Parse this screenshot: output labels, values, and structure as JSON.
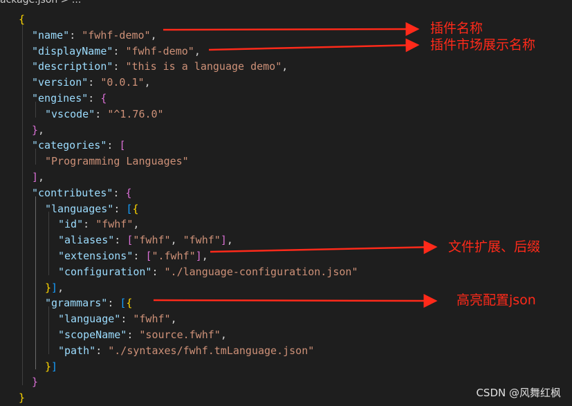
{
  "breadcrumb": {
    "text": "ackage.json > ..."
  },
  "colors": {
    "key": "#9cdcfe",
    "string": "#ce9178",
    "punctuation": "#d4d4d4",
    "bracket_level_1": "#ffd700",
    "bracket_level_2": "#da70d6",
    "bracket_level_3": "#179fff",
    "annotation": "#ff2a1a",
    "background": "#1e1e1e"
  },
  "code": {
    "lines": [
      [
        [
          "b1",
          "{"
        ]
      ],
      [
        [
          "k",
          "\"name\""
        ],
        [
          "p",
          ": "
        ],
        [
          "s",
          "\"fwhf-demo\""
        ],
        [
          "p",
          ","
        ]
      ],
      [
        [
          "k",
          "\"displayName\""
        ],
        [
          "p",
          ": "
        ],
        [
          "s",
          "\"fwhf-demo\""
        ],
        [
          "p",
          ","
        ]
      ],
      [
        [
          "k",
          "\"description\""
        ],
        [
          "p",
          ": "
        ],
        [
          "s",
          "\"this is a language demo\""
        ],
        [
          "p",
          ","
        ]
      ],
      [
        [
          "k",
          "\"version\""
        ],
        [
          "p",
          ": "
        ],
        [
          "s",
          "\"0.0.1\""
        ],
        [
          "p",
          ","
        ]
      ],
      [
        [
          "k",
          "\"engines\""
        ],
        [
          "p",
          ": "
        ],
        [
          "b2",
          "{"
        ]
      ],
      [
        [
          "k",
          "\"vscode\""
        ],
        [
          "p",
          ": "
        ],
        [
          "s",
          "\"^1.76.0\""
        ]
      ],
      [
        [
          "b2",
          "}"
        ],
        [
          "p",
          ","
        ]
      ],
      [
        [
          "k",
          "\"categories\""
        ],
        [
          "p",
          ": "
        ],
        [
          "b2",
          "["
        ]
      ],
      [
        [
          "s",
          "\"Programming Languages\""
        ]
      ],
      [
        [
          "b2",
          "]"
        ],
        [
          "p",
          ","
        ]
      ],
      [
        [
          "k",
          "\"contributes\""
        ],
        [
          "p",
          ": "
        ],
        [
          "b2",
          "{"
        ]
      ],
      [
        [
          "k",
          "\"languages\""
        ],
        [
          "p",
          ": "
        ],
        [
          "b3",
          "["
        ],
        [
          "b1",
          "{"
        ]
      ],
      [
        [
          "k",
          "\"id\""
        ],
        [
          "p",
          ": "
        ],
        [
          "s",
          "\"fwhf\""
        ],
        [
          "p",
          ","
        ]
      ],
      [
        [
          "k",
          "\"aliases\""
        ],
        [
          "p",
          ": "
        ],
        [
          "b2",
          "["
        ],
        [
          "s",
          "\"fwhf\""
        ],
        [
          "p",
          ", "
        ],
        [
          "s",
          "\"fwhf\""
        ],
        [
          "b2",
          "]"
        ],
        [
          "p",
          ","
        ]
      ],
      [
        [
          "k",
          "\"extensions\""
        ],
        [
          "p",
          ": "
        ],
        [
          "b2",
          "["
        ],
        [
          "s",
          "\".fwhf\""
        ],
        [
          "b2",
          "]"
        ],
        [
          "p",
          ","
        ]
      ],
      [
        [
          "k",
          "\"configuration\""
        ],
        [
          "p",
          ": "
        ],
        [
          "s",
          "\"./language-configuration.json\""
        ]
      ],
      [
        [
          "b1",
          "}"
        ],
        [
          "b3",
          "]"
        ],
        [
          "p",
          ","
        ]
      ],
      [
        [
          "k",
          "\"grammars\""
        ],
        [
          "p",
          ": "
        ],
        [
          "b3",
          "["
        ],
        [
          "b1",
          "{"
        ]
      ],
      [
        [
          "k",
          "\"language\""
        ],
        [
          "p",
          ": "
        ],
        [
          "s",
          "\"fwhf\""
        ],
        [
          "p",
          ","
        ]
      ],
      [
        [
          "k",
          "\"scopeName\""
        ],
        [
          "p",
          ": "
        ],
        [
          "s",
          "\"source.fwhf\""
        ],
        [
          "p",
          ","
        ]
      ],
      [
        [
          "k",
          "\"path\""
        ],
        [
          "p",
          ": "
        ],
        [
          "s",
          "\"./syntaxes/fwhf.tmLanguage.json\""
        ]
      ],
      [
        [
          "b1",
          "}"
        ],
        [
          "b3",
          "]"
        ]
      ],
      [
        [
          "b2",
          "}"
        ]
      ],
      [
        [
          "b1",
          "}"
        ]
      ]
    ]
  },
  "annotations": [
    {
      "text": "插件名称"
    },
    {
      "text": "插件市场展示名称"
    },
    {
      "text": "文件扩展、后缀"
    },
    {
      "text": "高亮配置json"
    }
  ],
  "watermark": "CSDN @风舞红枫"
}
